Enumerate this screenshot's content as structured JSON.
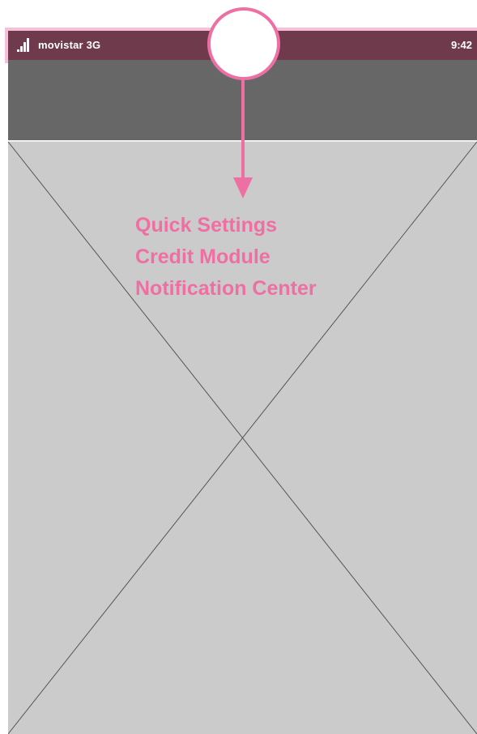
{
  "status_bar": {
    "carrier": "movistar 3G",
    "time": "9:42",
    "bar_color": "#6f3a4b"
  },
  "header": {
    "color": "#666766"
  },
  "content": {
    "placeholder_color": "#cbcbcb"
  },
  "annotation": {
    "color": "#ef6fa3",
    "lines": [
      "Quick Settings",
      "Credit Module",
      "Notification Center"
    ]
  },
  "icons": {
    "signal": "signal-strength-icon",
    "handle": "pull-down-handle-icon",
    "arrow": "arrow-down-icon"
  }
}
